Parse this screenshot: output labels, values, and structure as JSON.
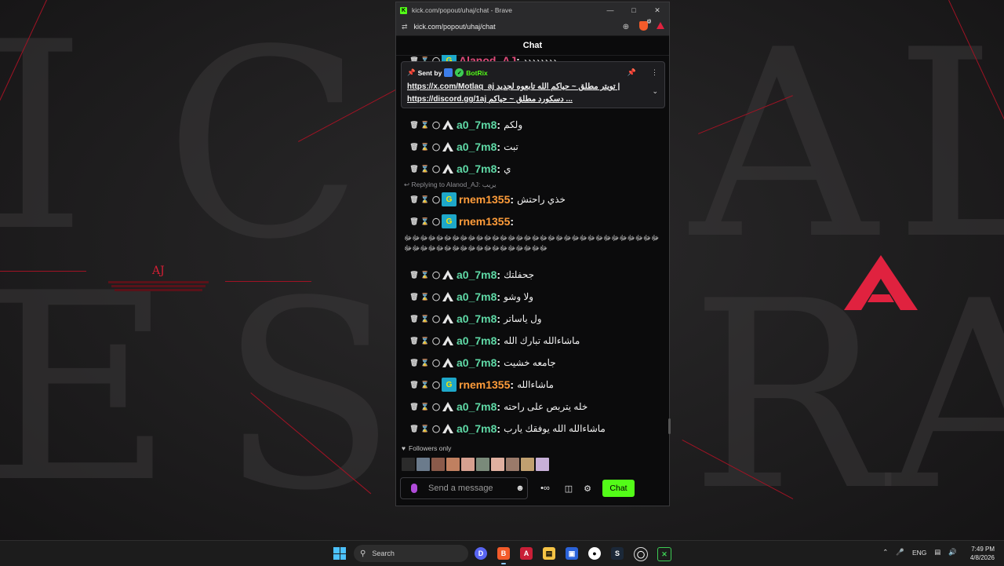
{
  "window": {
    "title": "kick.com/popout/uhaj/chat - Brave",
    "url": "kick.com/popout/uhaj/chat"
  },
  "chat": {
    "header": "Chat",
    "top_partial": {
      "username": "Alanod_AJ",
      "text": "ددددددددٍٍٍٍ"
    },
    "pinned": {
      "sent_by_label": "Sent by",
      "sender": "BotRix",
      "line1_link": "https://x.com/Motlaq_aj",
      "line1_text": "تويتر مطلق ~ حياكم الله تابعوه لجديد | ",
      "line2_link": "https://discord.gg/1aj",
      "line2_text": "دسكورد مطلق ~ حياكم ..."
    },
    "reply_hint": "Replying to Alanod_AJ: يريب",
    "long_text": "ﷻﷻﷻﷻﷻﷻﷻﷻﷻﷻﷻﷻﷻﷻﷻﷻﷻﷻﷻﷻﷻﷻﷻﷻﷻﷻﷻﷻﷻﷻﷻﷻﷻﷻﷻﷻﷻﷻﷻﷻﷻﷻﷻﷻﷻﷻﷻﷻﷻﷻ",
    "messages": [
      {
        "username": "a0_7m8",
        "text": "ولكم"
      },
      {
        "username": "a0_7m8",
        "text": "تبت"
      },
      {
        "username": "a0_7m8",
        "text": "ي"
      },
      {
        "username": "rnem1355",
        "text": "خذي راحتش"
      },
      {
        "username": "rnem1355",
        "text": ""
      },
      {
        "username": "a0_7m8",
        "text": "جحفلتك"
      },
      {
        "username": "a0_7m8",
        "text": "ولا وشو"
      },
      {
        "username": "a0_7m8",
        "text": "ول ياساتر"
      },
      {
        "username": "a0_7m8",
        "text": "ماشاءالله تبارك الله"
      },
      {
        "username": "a0_7m8",
        "text": "جامعه خشيت"
      },
      {
        "username": "rnem1355",
        "text": "ماشاءالله"
      },
      {
        "username": "a0_7m8",
        "text": "خله يتربص على راحته"
      },
      {
        "username": "a0_7m8",
        "text": "ماشاءالله الله يوفقك يارب"
      }
    ],
    "followers_only": "Followers only",
    "input_placeholder": "Send a message",
    "chat_button": "Chat"
  },
  "wallpaper": {
    "aj_tag": "AJ"
  },
  "taskbar": {
    "search_placeholder": "Search",
    "language": "ENG",
    "time": "7:49 PM",
    "date": "4/8/2026"
  },
  "colors": {
    "kick_green": "#53fc18",
    "username_green": "#5fd9a6",
    "username_orange": "#ff9c3a",
    "accent_red": "#d31f34"
  },
  "icons": [
    "trash-icon",
    "timeout-icon",
    "shield-icon",
    "pin-icon",
    "more-icon",
    "chevron-down-icon",
    "mic-icon",
    "emoji-icon",
    "gear-icon",
    "store-icon",
    "heart-icon"
  ]
}
